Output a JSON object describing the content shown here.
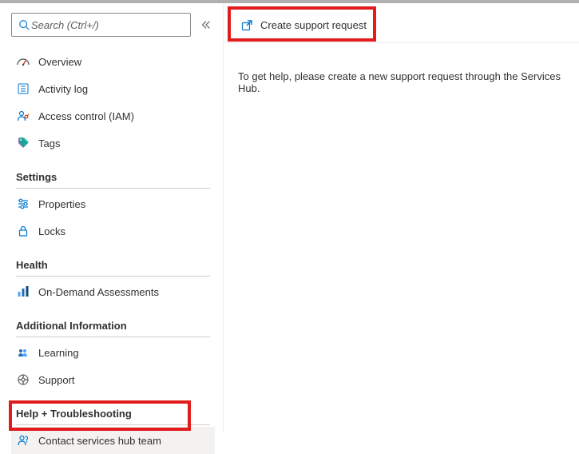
{
  "search": {
    "placeholder": "Search (Ctrl+/)"
  },
  "cmd": {
    "create": "Create support request"
  },
  "help_text": "To get help, please create a new support request through the Services Hub.",
  "nav_primary": {
    "overview": "Overview",
    "activity": "Activity log",
    "iam": "Access control (IAM)",
    "tags": "Tags"
  },
  "sections": {
    "settings": "Settings",
    "health": "Health",
    "additional": "Additional Information",
    "help": "Help + Troubleshooting"
  },
  "settings_items": {
    "properties": "Properties",
    "locks": "Locks"
  },
  "health_items": {
    "assessments": "On-Demand Assessments"
  },
  "additional_items": {
    "learning": "Learning",
    "support": "Support"
  },
  "help_items": {
    "contact": "Contact services hub team"
  }
}
